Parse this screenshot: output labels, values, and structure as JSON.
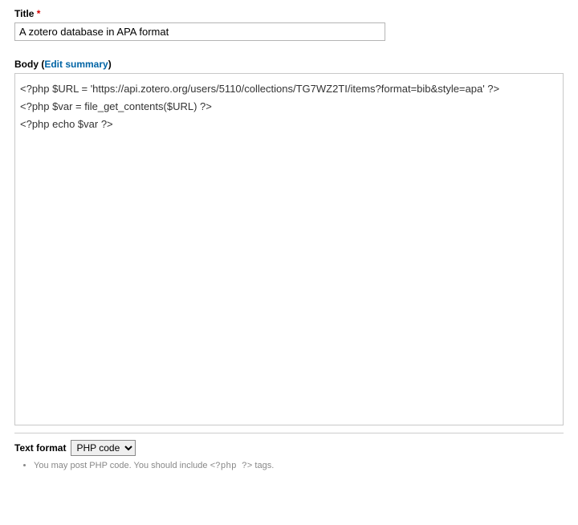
{
  "title_field": {
    "label": "Title",
    "required_marker": "*",
    "value": "A zotero database in APA format"
  },
  "body_field": {
    "label_prefix": "Body",
    "paren_open": " (",
    "edit_summary_link": "Edit summary",
    "paren_close": ")",
    "value": "<?php $URL = 'https://api.zotero.org/users/5110/collections/TG7WZ2TI/items?format=bib&style=apa' ?>\n<?php $var = file_get_contents($URL) ?>\n<?php echo $var ?>"
  },
  "text_format": {
    "label": "Text format",
    "selected": "PHP code",
    "options": [
      "PHP code"
    ]
  },
  "hints": {
    "line_prefix": "You may post PHP code. You should include ",
    "code": "<?php ?>",
    "line_suffix": " tags."
  }
}
